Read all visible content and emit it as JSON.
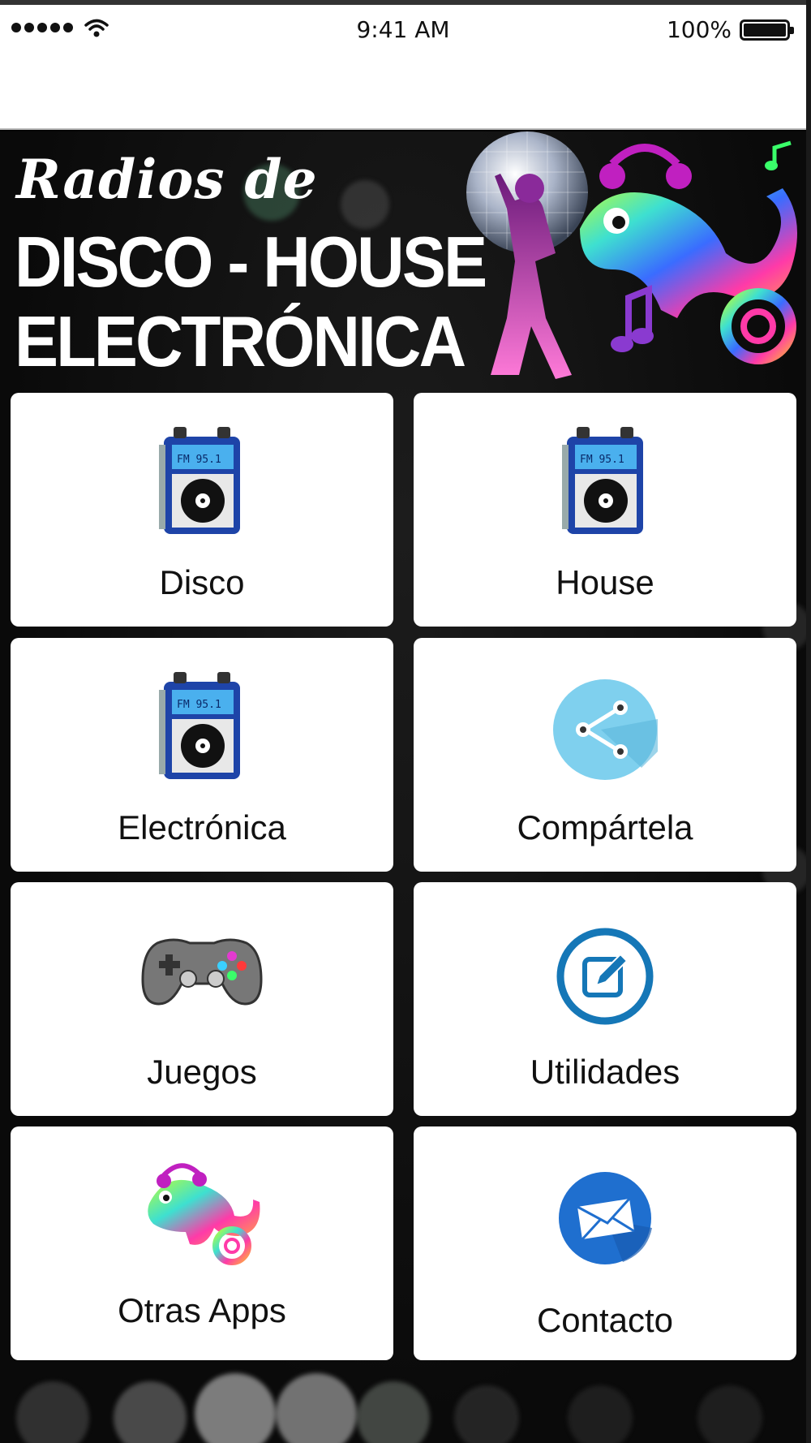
{
  "status_bar": {
    "time": "9:41 AM",
    "battery": "100%",
    "signal_icon": "signal-dots-icon",
    "wifi_icon": "wifi-icon",
    "battery_icon": "battery-icon"
  },
  "banner": {
    "line1": "Radios de",
    "line2": "DISCO - HOUSE",
    "line3": "ELECTRÓNICA",
    "art_icon": "disco-chameleon-artwork"
  },
  "menu": [
    {
      "label": "Disco",
      "icon": "radio-icon"
    },
    {
      "label": "House",
      "icon": "radio-icon"
    },
    {
      "label": "Electrónica",
      "icon": "radio-icon"
    },
    {
      "label": "Compártela",
      "icon": "share-icon"
    },
    {
      "label": "Juegos",
      "icon": "gamepad-icon"
    },
    {
      "label": "Utilidades",
      "icon": "edit-icon"
    },
    {
      "label": "Otras Apps",
      "icon": "chameleon-icon"
    },
    {
      "label": "Contacto",
      "icon": "mail-icon"
    }
  ],
  "colors": {
    "background": "#050505",
    "tile": "#ffffff",
    "radio_blue": "#1e44a8",
    "share_blue": "#7fd0ee",
    "edit_blue": "#1577b7",
    "mail_blue": "#1f6fcf"
  }
}
